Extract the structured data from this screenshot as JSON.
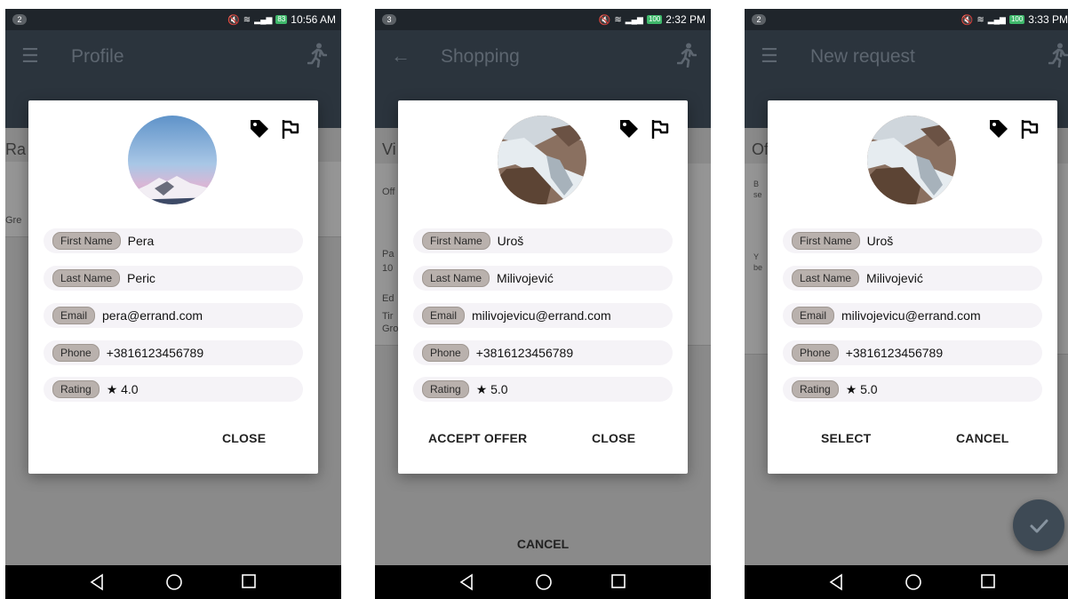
{
  "screens": [
    {
      "status_badge": "2",
      "status_time": "10:56 AM",
      "battery": "83",
      "app_title": "Profile",
      "bg_letters": [
        "Ra",
        "Gre"
      ],
      "profile": {
        "fields": [
          {
            "label": "First Name",
            "value": "Pera"
          },
          {
            "label": "Last Name",
            "value": "Peric"
          },
          {
            "label": "Email",
            "value": "pera@errand.com"
          },
          {
            "label": "Phone",
            "value": "+3816123456789"
          },
          {
            "label": "Rating",
            "value": "★ 4.0"
          }
        ],
        "buttons": [
          "CLOSE"
        ]
      }
    },
    {
      "status_badge": "3",
      "status_time": "2:32 PM",
      "battery": "100",
      "app_title": "Shopping",
      "bg_letters": [
        "Vi",
        "Off",
        "Pa",
        "10",
        "Ed",
        "Tir",
        "Gro"
      ],
      "profile": {
        "fields": [
          {
            "label": "First Name",
            "value": "Uroš"
          },
          {
            "label": "Last Name",
            "value": "Milivojević"
          },
          {
            "label": "Email",
            "value": "milivojevicu@errand.com"
          },
          {
            "label": "Phone",
            "value": "+3816123456789"
          },
          {
            "label": "Rating",
            "value": "★ 5.0"
          }
        ],
        "buttons": [
          "ACCEPT OFFER",
          "CLOSE"
        ]
      },
      "bottom_action": "CANCEL"
    },
    {
      "status_badge": "2",
      "status_time": "3:33 PM",
      "battery": "100",
      "app_title": "New request",
      "bg_letters": [
        "Of",
        "B",
        "se",
        "Y",
        "be"
      ],
      "profile": {
        "fields": [
          {
            "label": "First Name",
            "value": "Uroš"
          },
          {
            "label": "Last Name",
            "value": "Milivojević"
          },
          {
            "label": "Email",
            "value": "milivojevicu@errand.com"
          },
          {
            "label": "Phone",
            "value": "+3816123456789"
          },
          {
            "label": "Rating",
            "value": "★ 5.0"
          }
        ],
        "buttons": [
          "SELECT",
          "CANCEL"
        ]
      }
    }
  ],
  "icons": {
    "menu": "menu-icon",
    "back": "arrow-back-icon",
    "runner": "runner-icon",
    "tag": "tag-icon",
    "flag": "flag-icon",
    "check": "check-icon",
    "nav": [
      "nav-back-icon",
      "nav-home-icon",
      "nav-recents-icon"
    ]
  },
  "colors": {
    "appbar": "#2b343d",
    "chip": "#b9b1ad",
    "field_bg": "#f5f3f7",
    "battery": "#3fb86b"
  }
}
